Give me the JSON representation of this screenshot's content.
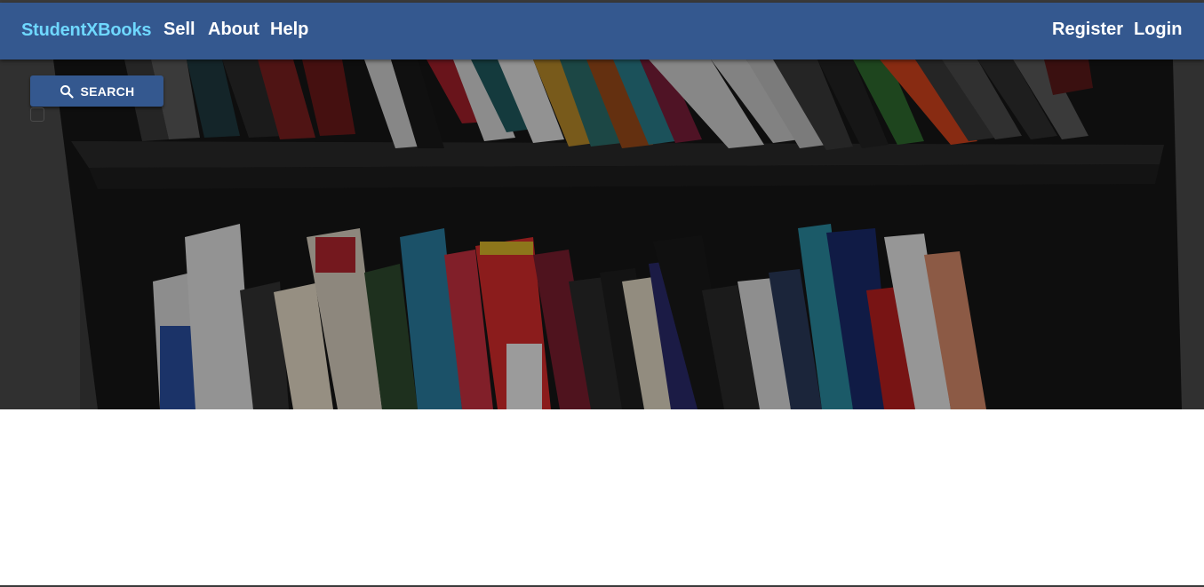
{
  "navbar": {
    "brand": "StudentXBooks",
    "links": [
      {
        "label": "Sell"
      },
      {
        "label": "About"
      },
      {
        "label": "Help"
      }
    ],
    "auth": {
      "register_label": "Register",
      "login_label": "Login"
    },
    "color": "#34588f",
    "brand_color": "#6fd8ff"
  },
  "hero": {
    "image": "bookshelf-photo",
    "search_button": {
      "label": "SEARCH",
      "icon": "search-icon"
    }
  }
}
